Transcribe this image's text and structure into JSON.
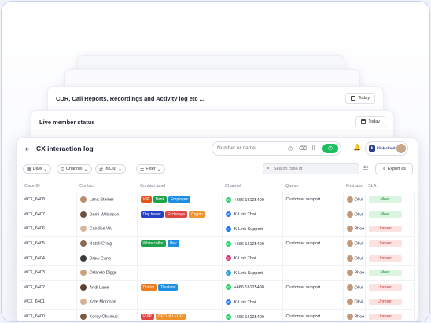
{
  "cards": {
    "cdr": {
      "title": "CDR, Call Reports, Recordings and Activity log etc ...",
      "today_label": "Today"
    },
    "live": {
      "title": "Live member status",
      "today_label": "Today"
    }
  },
  "header": {
    "title": "CX interaction log",
    "dial_placeholder": "Number or name ...",
    "brand_text": "klink.cloud"
  },
  "filters": {
    "date": "Date",
    "channel": "Channel",
    "inout": "In/Out",
    "filter": "Filter",
    "search_placeholder": "Search case id",
    "export": "Export as"
  },
  "columns": [
    "Case ID",
    "Contact",
    "Contact label",
    "Channel",
    "Queue",
    "First assi",
    "SLA"
  ],
  "colors": {
    "VIP": "#e8551f",
    "Bank": "#1fa34a",
    "Employee": "#1e8fe0",
    "Day trader": "#2941c9",
    "Exchange": "#e04646",
    "Crypto": "#f0932b",
    "White collar": "#1fa34a",
    "Dev": "#1e8fe0",
    "Doctor": "#f07a1e",
    "Thailand": "#1e8fe0",
    "VVIP": "#e04646",
    "CEO of LEGO": "#f0932b",
    "whatsapp": "#25d366",
    "messenger": "#2f7bf5",
    "facebook": "#1877f2",
    "instagram": "#d6307a",
    "telegram": "#2aa3de"
  },
  "rows": [
    {
      "case_id": "#CX_6408",
      "contact": "Lana Steiner",
      "avatar": "#b98d6e",
      "labels": [
        "VIP",
        "Bank",
        "Employee"
      ],
      "channel_icon": "whatsapp",
      "channel": "+666 16125490",
      "queue": "Customer support",
      "assignee": "Olivi",
      "sla": "Meet"
    },
    {
      "case_id": "#CX_6407",
      "contact": "Demi Wilkinson",
      "avatar": "#6b4f3f",
      "labels": [
        "Day trader",
        "Exchange",
        "Crypto"
      ],
      "channel_icon": "messenger",
      "channel": "K-Link Thai",
      "queue": "",
      "assignee": "Olivi",
      "sla": "Meet"
    },
    {
      "case_id": "#CX_6406",
      "contact": "Candice Wu",
      "avatar": "#d7b79b",
      "labels": [],
      "channel_icon": "facebook",
      "channel": "K-Link Support",
      "queue": "",
      "assignee": "Phoe",
      "sla": "Unmeet"
    },
    {
      "case_id": "#CX_6405",
      "contact": "Natali Craig",
      "avatar": "#8c6a52",
      "labels": [
        "White collar",
        "Dev"
      ],
      "channel_icon": "whatsapp",
      "channel": "+666 16125490",
      "queue": "Customer support",
      "assignee": "Olivi",
      "sla": "Unmeet"
    },
    {
      "case_id": "#CX_6404",
      "contact": "Drew Cano",
      "avatar": "#3e3a3a",
      "labels": [],
      "channel_icon": "instagram",
      "channel": "K-Link Thai",
      "queue": "",
      "assignee": "Olivi",
      "sla": "Unmeet"
    },
    {
      "case_id": "#CX_6403",
      "contact": "Orlando Diggs",
      "avatar": "#c9a17f",
      "labels": [],
      "channel_icon": "telegram",
      "channel": "K-Link Support",
      "queue": "",
      "assignee": "Phoe",
      "sla": "Meet"
    },
    {
      "case_id": "#CX_6402",
      "contact": "Andi Lane",
      "avatar": "#5b4030",
      "labels": [
        "Doctor",
        "Thailand"
      ],
      "channel_icon": "whatsapp",
      "channel": "+666 16125490",
      "queue": "Customer support",
      "assignee": "Olivi",
      "sla": "Unmeet"
    },
    {
      "case_id": "#CX_6401",
      "contact": "Kate Morrison",
      "avatar": "#d4b296",
      "labels": [],
      "channel_icon": "messenger",
      "channel": "K-Link Thai",
      "queue": "",
      "assignee": "Olivi",
      "sla": "Unmeet"
    },
    {
      "case_id": "#CX_6400",
      "contact": "Koray Okumus",
      "avatar": "#7a5a44",
      "labels": [
        "VVIP",
        "CEO of LEGO"
      ],
      "channel_icon": "whatsapp",
      "channel": "+666 16125490",
      "queue": "Customer support",
      "assignee": "Phoe",
      "sla": "Unmeet"
    }
  ]
}
